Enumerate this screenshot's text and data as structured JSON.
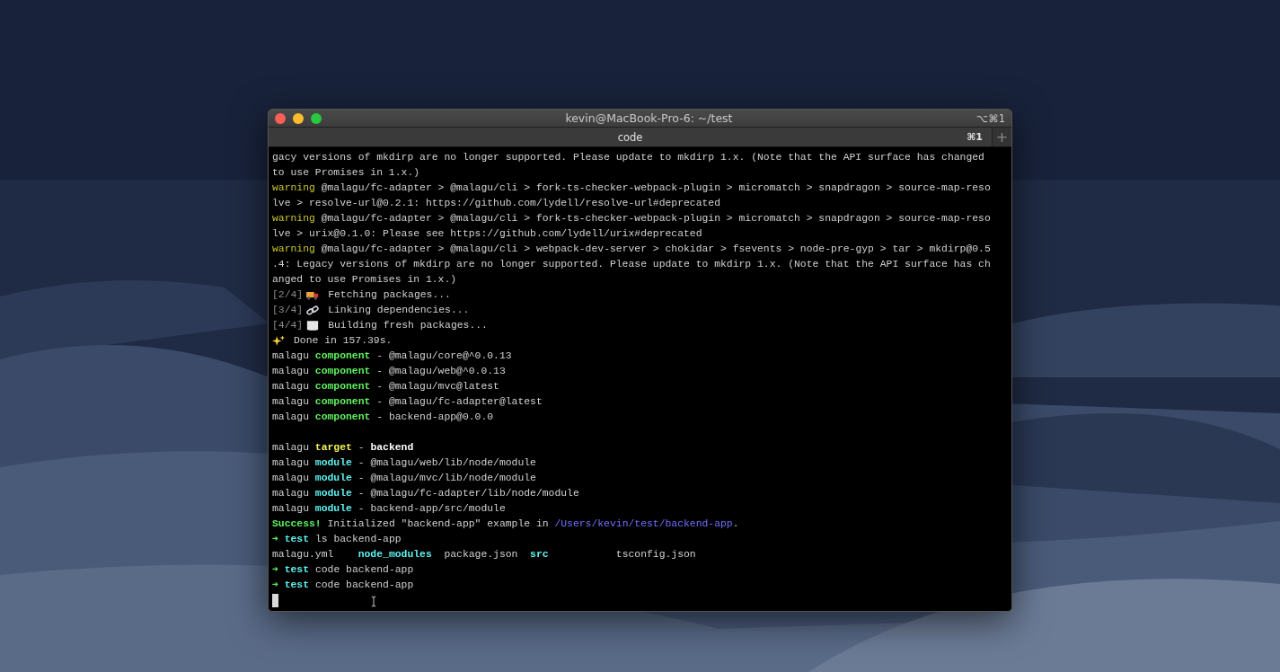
{
  "window": {
    "title": "kevin@MacBook-Pro-6: ~/test",
    "shortcut": "⌥⌘1"
  },
  "tabs": [
    {
      "label": "code",
      "shortcut": "⌘1",
      "selected": true
    }
  ],
  "new_tab": "+",
  "terminal": {
    "lines": [
      [
        {
          "text": "gacy versions of mkdirp are no longer supported. Please update to mkdirp 1.x. (Note that the API surface has changed",
          "kind": "plain"
        }
      ],
      [
        {
          "text": "to use Promises in 1.x.)",
          "kind": "plain"
        }
      ],
      [
        {
          "text": "warning",
          "kind": "warning"
        },
        {
          "text": " @malagu/fc-adapter > @malagu/cli > fork-ts-checker-webpack-plugin > micromatch > snapdragon > source-map-reso",
          "kind": "plain"
        }
      ],
      [
        {
          "text": "lve > resolve-url@0.2.1: https://github.com/lydell/resolve-url#deprecated",
          "kind": "plain"
        }
      ],
      [
        {
          "text": "warning",
          "kind": "warning"
        },
        {
          "text": " @malagu/fc-adapter > @malagu/cli > fork-ts-checker-webpack-plugin > micromatch > snapdragon > source-map-reso",
          "kind": "plain"
        }
      ],
      [
        {
          "text": "lve > urix@0.1.0: Please see https://github.com/lydell/urix#deprecated",
          "kind": "plain"
        }
      ],
      [
        {
          "text": "warning",
          "kind": "warning"
        },
        {
          "text": " @malagu/fc-adapter > @malagu/cli > webpack-dev-server > chokidar > fsevents > node-pre-gyp > tar > mkdirp@0.5",
          "kind": "plain"
        }
      ],
      [
        {
          "text": ".4: Legacy versions of mkdirp are no longer supported. Please update to mkdirp 1.x. (Note that the API surface has ch",
          "kind": "plain"
        }
      ],
      [
        {
          "text": "anged to use Promises in 1.x.)",
          "kind": "plain"
        }
      ],
      [
        {
          "text": "[2/4]",
          "kind": "dim"
        },
        {
          "kind": "truck"
        },
        {
          "text": "Fetching packages...",
          "kind": "plain"
        }
      ],
      [
        {
          "text": "[3/4]",
          "kind": "dim"
        },
        {
          "kind": "link"
        },
        {
          "text": "Linking dependencies...",
          "kind": "plain"
        }
      ],
      [
        {
          "text": "[4/4]",
          "kind": "dim"
        },
        {
          "kind": "page"
        },
        {
          "text": "Building fresh packages...",
          "kind": "plain"
        }
      ],
      [
        {
          "kind": "sparkle"
        },
        {
          "text": "Done in 157.39s.",
          "kind": "plain"
        }
      ],
      [
        {
          "text": "malagu ",
          "kind": "plain"
        },
        {
          "text": "component",
          "kind": "green"
        },
        {
          "text": " - @malagu/core@^0.0.13",
          "kind": "plain"
        }
      ],
      [
        {
          "text": "malagu ",
          "kind": "plain"
        },
        {
          "text": "component",
          "kind": "green"
        },
        {
          "text": " - @malagu/web@^0.0.13",
          "kind": "plain"
        }
      ],
      [
        {
          "text": "malagu ",
          "kind": "plain"
        },
        {
          "text": "component",
          "kind": "green"
        },
        {
          "text": " - @malagu/mvc@latest",
          "kind": "plain"
        }
      ],
      [
        {
          "text": "malagu ",
          "kind": "plain"
        },
        {
          "text": "component",
          "kind": "green"
        },
        {
          "text": " - @malagu/fc-adapter@latest",
          "kind": "plain"
        }
      ],
      [
        {
          "text": "malagu ",
          "kind": "plain"
        },
        {
          "text": "component",
          "kind": "green"
        },
        {
          "text": " - backend-app@0.0.0",
          "kind": "plain"
        }
      ],
      [
        {
          "kind": "blank"
        }
      ],
      [
        {
          "text": "malagu ",
          "kind": "plain"
        },
        {
          "text": "target",
          "kind": "yellow"
        },
        {
          "text": " - ",
          "kind": "plain"
        },
        {
          "text": "backend",
          "kind": "bold"
        }
      ],
      [
        {
          "text": "malagu ",
          "kind": "plain"
        },
        {
          "text": "module",
          "kind": "cyan"
        },
        {
          "text": " - @malagu/web/lib/node/module",
          "kind": "plain"
        }
      ],
      [
        {
          "text": "malagu ",
          "kind": "plain"
        },
        {
          "text": "module",
          "kind": "cyan"
        },
        {
          "text": " - @malagu/mvc/lib/node/module",
          "kind": "plain"
        }
      ],
      [
        {
          "text": "malagu ",
          "kind": "plain"
        },
        {
          "text": "module",
          "kind": "cyan"
        },
        {
          "text": " - @malagu/fc-adapter/lib/node/module",
          "kind": "plain"
        }
      ],
      [
        {
          "text": "malagu ",
          "kind": "plain"
        },
        {
          "text": "module",
          "kind": "cyan"
        },
        {
          "text": " - backend-app/src/module",
          "kind": "plain"
        }
      ],
      [
        {
          "text": "Success!",
          "kind": "green"
        },
        {
          "text": " Initialized \"backend-app\" example in ",
          "kind": "plain"
        },
        {
          "text": "/Users/kevin/test/backend-app",
          "kind": "blue"
        },
        {
          "text": ".",
          "kind": "plain"
        }
      ],
      [
        {
          "text": "➜",
          "kind": "green"
        },
        {
          "text": " test",
          "kind": "cyan"
        },
        {
          "text": " ls backend-app",
          "kind": "plain"
        }
      ],
      [
        {
          "text": "malagu.yml",
          "kind": "plain"
        },
        {
          "text": "    node_modules",
          "kind": "cyan"
        },
        {
          "text": "  package.json",
          "kind": "plain"
        },
        {
          "text": "  src",
          "kind": "cyan"
        },
        {
          "text": "           tsconfig.json",
          "kind": "plain"
        }
      ],
      [
        {
          "text": "➜",
          "kind": "green"
        },
        {
          "text": " test",
          "kind": "cyan"
        },
        {
          "text": " code backend-app",
          "kind": "plain"
        }
      ],
      [
        {
          "text": "➜",
          "kind": "green"
        },
        {
          "text": " test",
          "kind": "cyan"
        },
        {
          "text": " code backend-app",
          "kind": "plain"
        }
      ],
      [
        {
          "kind": "cursor"
        }
      ]
    ]
  }
}
